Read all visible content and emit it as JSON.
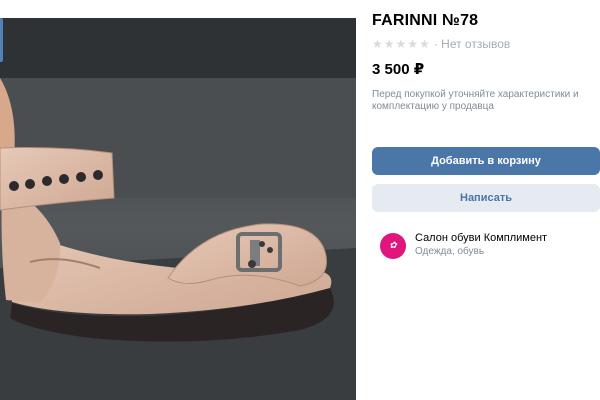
{
  "product": {
    "title": "FARINNI №78",
    "reviews_text": "· Нет отзывов",
    "rating_stars": 0,
    "rating_max": 5,
    "price": "3 500 ₽",
    "note": "Перед покупкой уточняйте характеристики и комплектацию у продавца"
  },
  "actions": {
    "add_to_cart": "Добавить в корзину",
    "message": "Написать"
  },
  "seller": {
    "name": "Салон обуви Комплимент",
    "category": "Одежда, обувь"
  },
  "colors": {
    "primary_button": "#4a76a8",
    "secondary_button": "#e5ebf1",
    "avatar": "#e0167c",
    "muted_text": "#818c99"
  }
}
